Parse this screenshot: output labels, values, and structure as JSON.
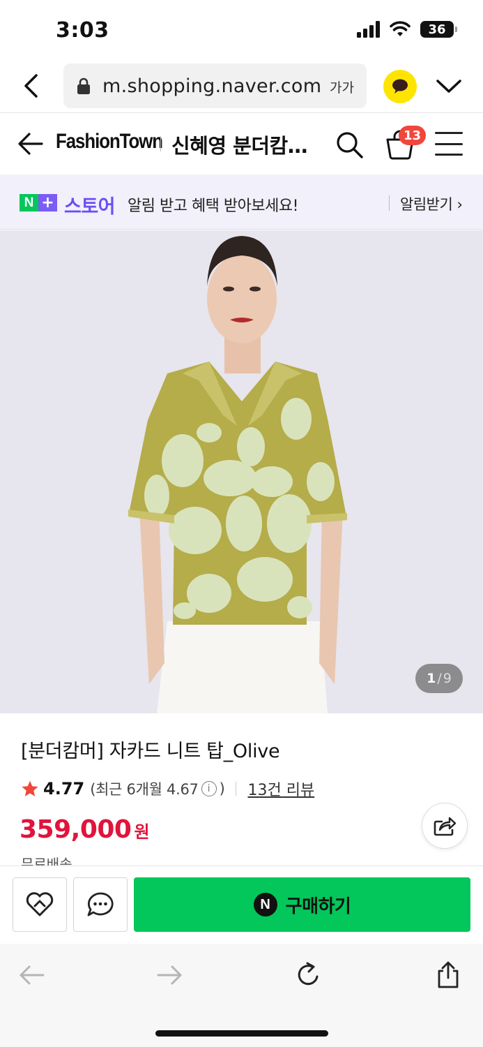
{
  "status_bar": {
    "time": "3:03",
    "battery": "36"
  },
  "browser": {
    "url": "m.shopping.naver.com",
    "text_size_label": "가가"
  },
  "store_header": {
    "brand": "FashionTown",
    "title": "신혜영 분더캄…",
    "cart_count": "13"
  },
  "notification": {
    "n_label": "N",
    "plus_label": "+",
    "store_label": "스토어",
    "message": "알림 받고 혜택 받아보세요!",
    "action": "알림받기 ›"
  },
  "gallery": {
    "current": "1",
    "separator": "/",
    "total": "9"
  },
  "product": {
    "title": "[분더캄머] 자카드 니트 탑_Olive",
    "rating": "4.77",
    "recent_rating": "(최근 6개월 4.67",
    "recent_close": ")",
    "info_symbol": "i",
    "reviews": "13건 리뷰",
    "price": "359,000",
    "price_unit": "원",
    "shipping": "무료배송"
  },
  "purchase_bar": {
    "buy_icon_letter": "N",
    "buy_label": "구매하기"
  },
  "colors": {
    "naver_green": "#03c75a",
    "price_red": "#e0143c",
    "store_purple": "#6c4df5",
    "badge_red": "#f0463c",
    "kakao_yellow": "#fee500"
  },
  "icons": [
    "chevron-left-icon",
    "lock-icon",
    "kakaotalk-icon",
    "chevron-down-icon",
    "arrow-left-icon",
    "search-icon",
    "cart-icon",
    "menu-icon",
    "star-icon",
    "info-icon",
    "share-icon",
    "heart-icon",
    "chat-icon",
    "back-arrow-icon",
    "forward-arrow-icon",
    "reload-icon",
    "share-upload-icon"
  ]
}
